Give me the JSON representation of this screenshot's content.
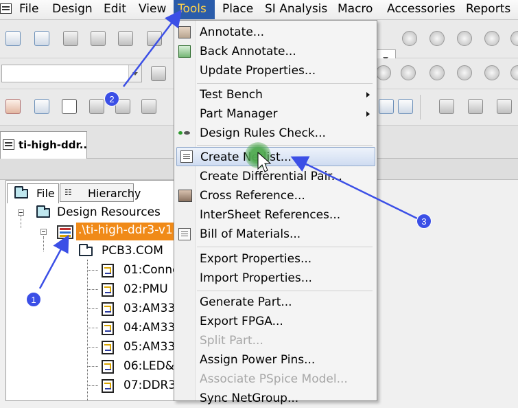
{
  "menubar": {
    "items": [
      {
        "label": "File"
      },
      {
        "label": "Design"
      },
      {
        "label": "Edit"
      },
      {
        "label": "View"
      },
      {
        "label": "Tools"
      },
      {
        "label": "Place"
      },
      {
        "label": "SI Analysis"
      },
      {
        "label": "Macro"
      },
      {
        "label": "Accessories"
      },
      {
        "label": "Reports"
      }
    ],
    "active": "Tools"
  },
  "document_tab": {
    "label": "ti-high-ddr..."
  },
  "project_pane": {
    "tabs": [
      {
        "label": "File"
      },
      {
        "label": "Hierarchy"
      }
    ],
    "tree": {
      "root": "Design Resources",
      "design": ".\\ti-high-ddr3-v1",
      "folder": "PCB3.COM",
      "pages": [
        "01:Conne",
        "02:PMU",
        "03:AM33",
        "04:AM33",
        "05:AM33",
        "06:LED&",
        "07:DDR3"
      ]
    }
  },
  "tools_menu": {
    "items": [
      {
        "label": "Annotate...",
        "icon": "annotate-icon"
      },
      {
        "label": "Back Annotate...",
        "icon": "back-annotate-icon"
      },
      {
        "label": "Update Properties..."
      },
      {
        "label": "Test Bench",
        "submenu": true
      },
      {
        "label": "Part Manager",
        "submenu": true
      },
      {
        "label": "Design Rules Check...",
        "icon": "drc-icon"
      },
      {
        "label": "Create Netlist...",
        "icon": "netlist-icon",
        "highlighted": true
      },
      {
        "label": "Create Differential Pair..."
      },
      {
        "label": "Cross Reference...",
        "icon": "cross-reference-icon"
      },
      {
        "label": "InterSheet References..."
      },
      {
        "label": "Bill of Materials...",
        "icon": "bom-icon"
      },
      {
        "label": "Export Properties..."
      },
      {
        "label": "Import Properties..."
      },
      {
        "label": "Generate Part..."
      },
      {
        "label": "Export FPGA..."
      },
      {
        "label": "Split Part...",
        "disabled": true
      },
      {
        "label": "Assign Power Pins..."
      },
      {
        "label": "Associate PSpice Model...",
        "disabled": true
      },
      {
        "label": "Sync NetGroup..."
      }
    ]
  },
  "annotations": {
    "badges": [
      "1",
      "2",
      "3"
    ],
    "arrow_color": "#3b4fe6"
  },
  "colors": {
    "menu_active_bg": "#2a5caa",
    "menu_active_fg": "#ffd24a",
    "selection": "#f08a18",
    "highlight_border": "#8fa8cc"
  }
}
